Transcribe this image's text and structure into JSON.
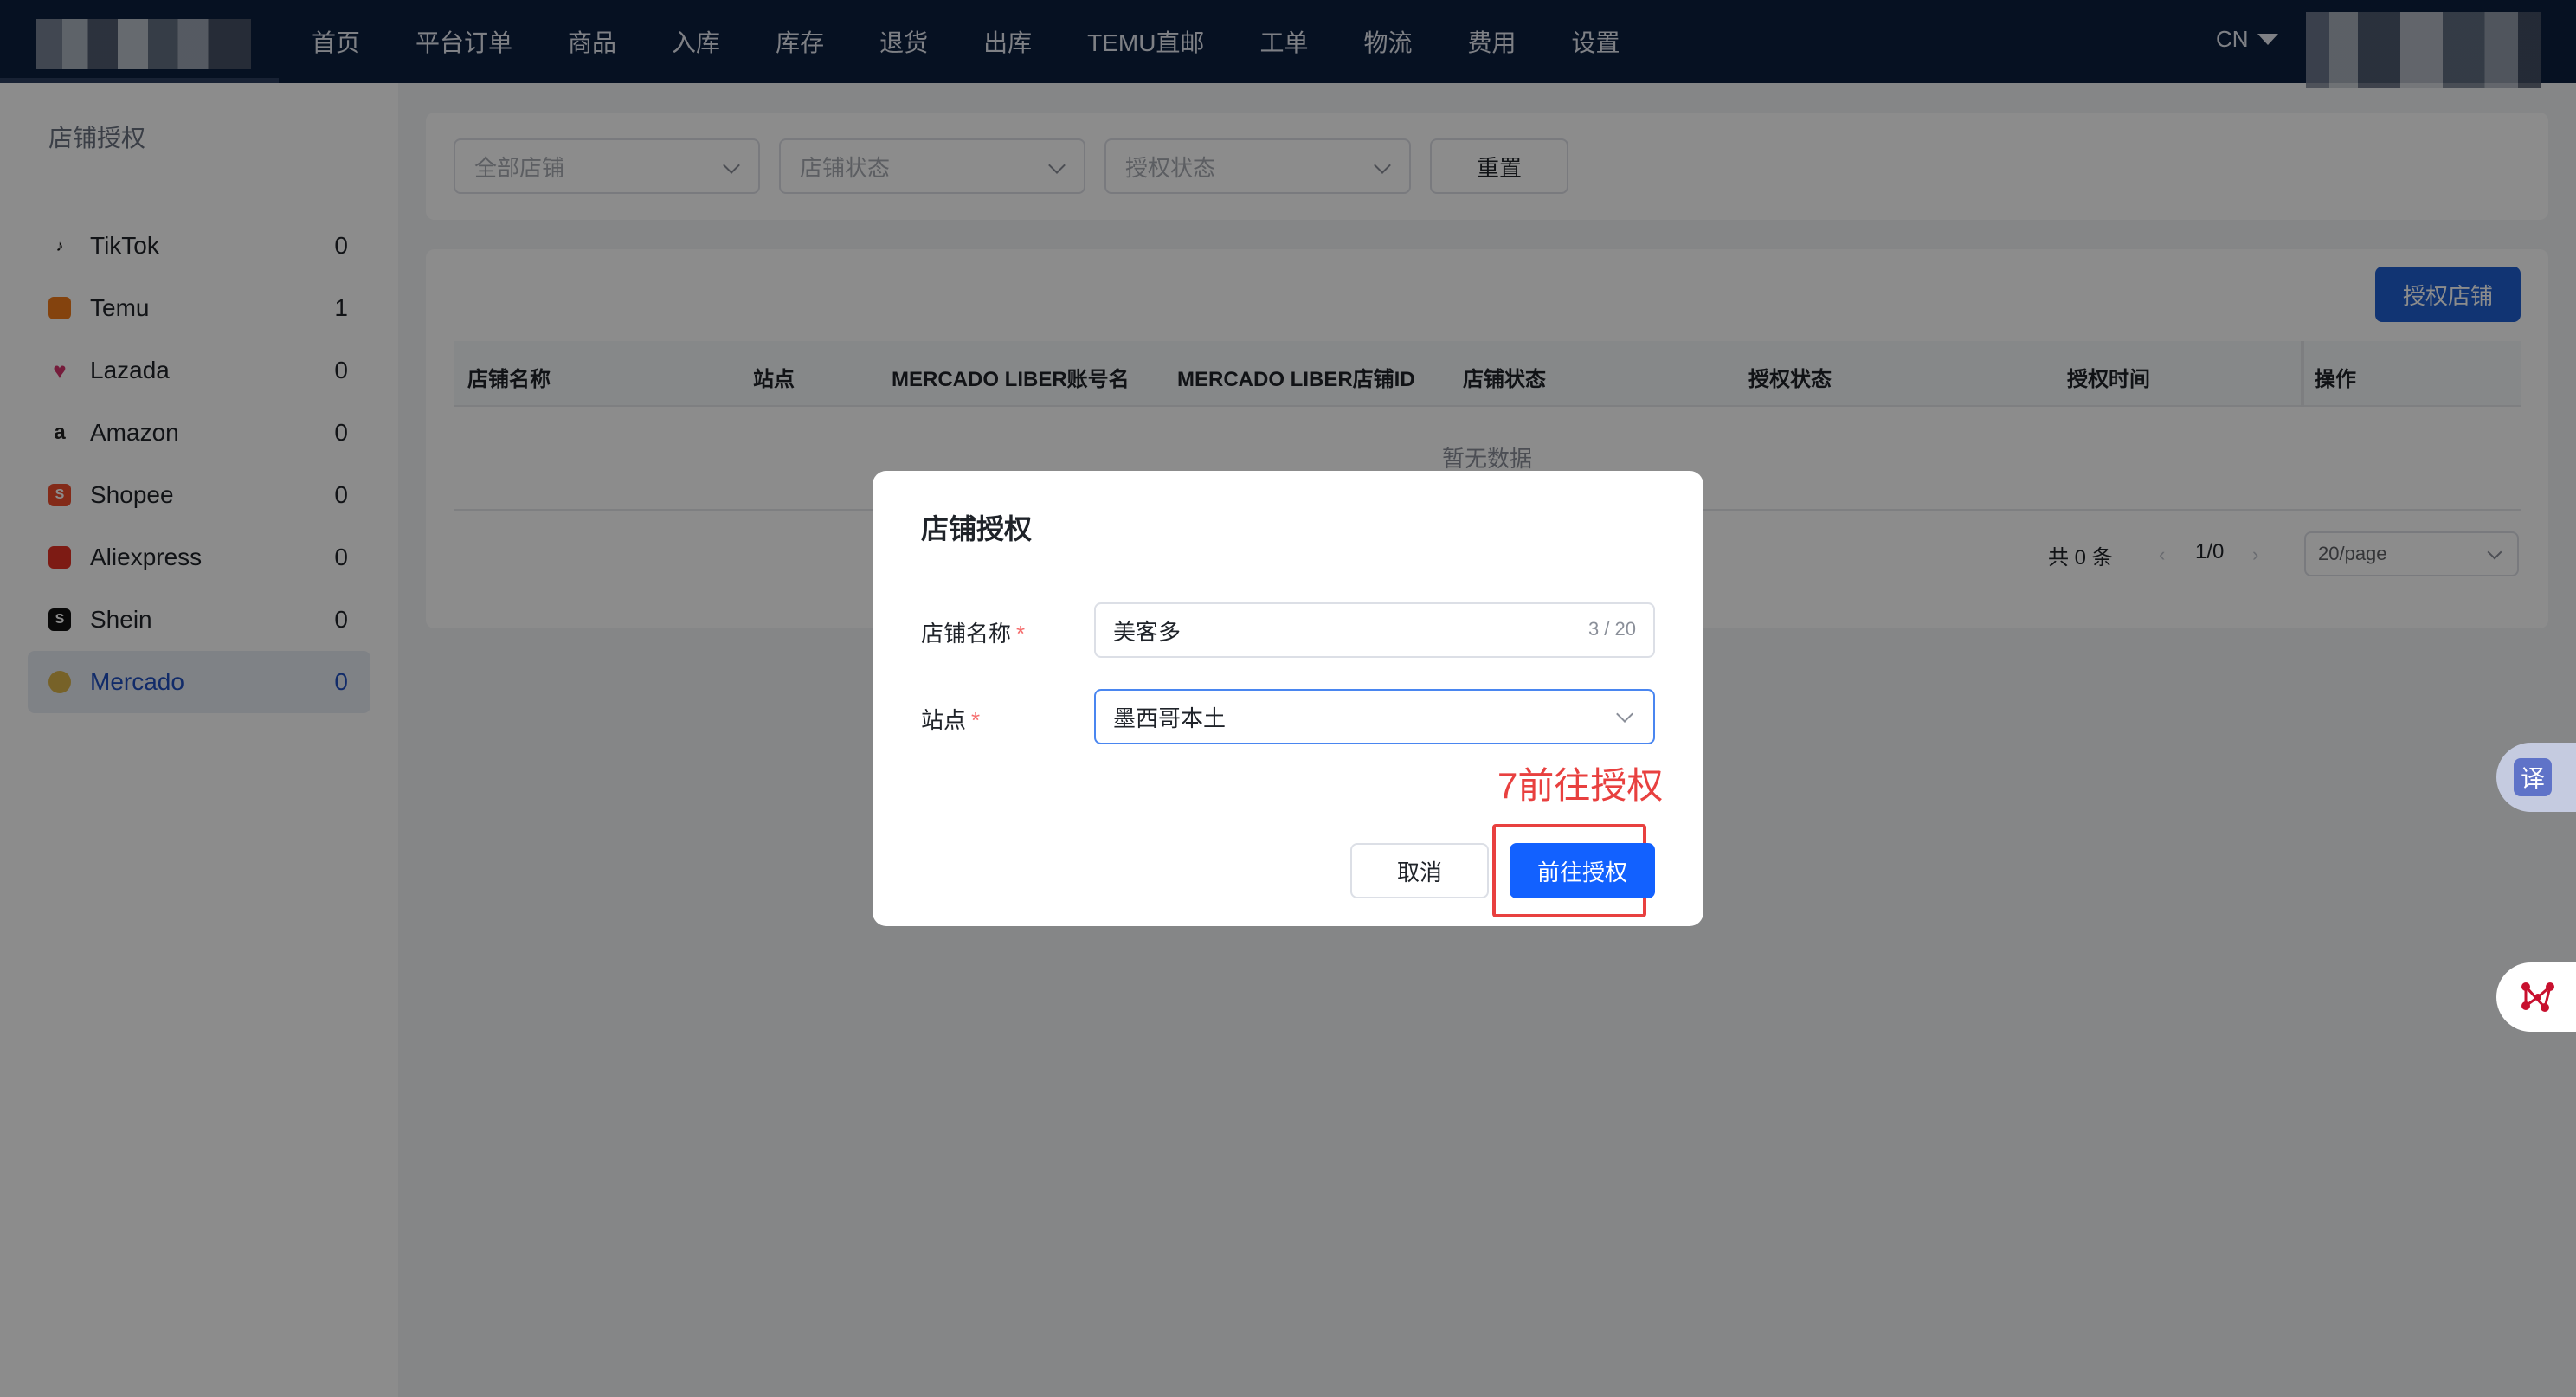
{
  "nav": {
    "items": [
      "首页",
      "平台订单",
      "商品",
      "入库",
      "库存",
      "退货",
      "出库",
      "TEMU直邮",
      "工单",
      "物流",
      "费用",
      "设置"
    ],
    "lang": "CN"
  },
  "sidebar": {
    "title": "店铺授权",
    "items": [
      {
        "label": "TikTok",
        "count": "0",
        "icon": "tiktok-icon",
        "color": "#111111"
      },
      {
        "label": "Temu",
        "count": "1",
        "icon": "temu-icon",
        "color": "#f07a1a"
      },
      {
        "label": "Lazada",
        "count": "0",
        "icon": "lazada-icon",
        "color": "#d6336c"
      },
      {
        "label": "Amazon",
        "count": "0",
        "icon": "amazon-icon",
        "color": "#222222"
      },
      {
        "label": "Shopee",
        "count": "0",
        "icon": "shopee-icon",
        "color": "#ee4d2d"
      },
      {
        "label": "Aliexpress",
        "count": "0",
        "icon": "aliexpress-icon",
        "color": "#e43225"
      },
      {
        "label": "Shein",
        "count": "0",
        "icon": "shein-icon",
        "color": "#111111"
      },
      {
        "label": "Mercado",
        "count": "0",
        "icon": "mercado-icon",
        "color": "#d9b34a"
      }
    ],
    "active_index": 7
  },
  "filters": {
    "store_placeholder": "全部店铺",
    "store_status_placeholder": "店铺状态",
    "auth_status_placeholder": "授权状态",
    "reset_label": "重置"
  },
  "table": {
    "auth_shop_label": "授权店铺",
    "columns": [
      "店铺名称",
      "站点",
      "MERCADO LIBER账号名",
      "MERCADO LIBER店铺ID",
      "店铺状态",
      "授权状态",
      "授权时间",
      "操作"
    ],
    "empty_text": "暂无数据",
    "total_text": "共 0 条",
    "page_text": "1/0",
    "page_size": "20/page"
  },
  "dialog": {
    "title": "店铺授权",
    "name_label": "店铺名称",
    "name_value": "美客多",
    "name_count": "3 / 20",
    "site_label": "站点",
    "site_value": "墨西哥本土",
    "required_mark": "*",
    "annotation": "7前往授权",
    "cancel_label": "取消",
    "go_label": "前往授权"
  },
  "widgets": {
    "translate_glyph": "译"
  },
  "colors": {
    "nav_bg": "#0b1f3f",
    "primary": "#1261ff",
    "annotation": "#e8403f"
  }
}
